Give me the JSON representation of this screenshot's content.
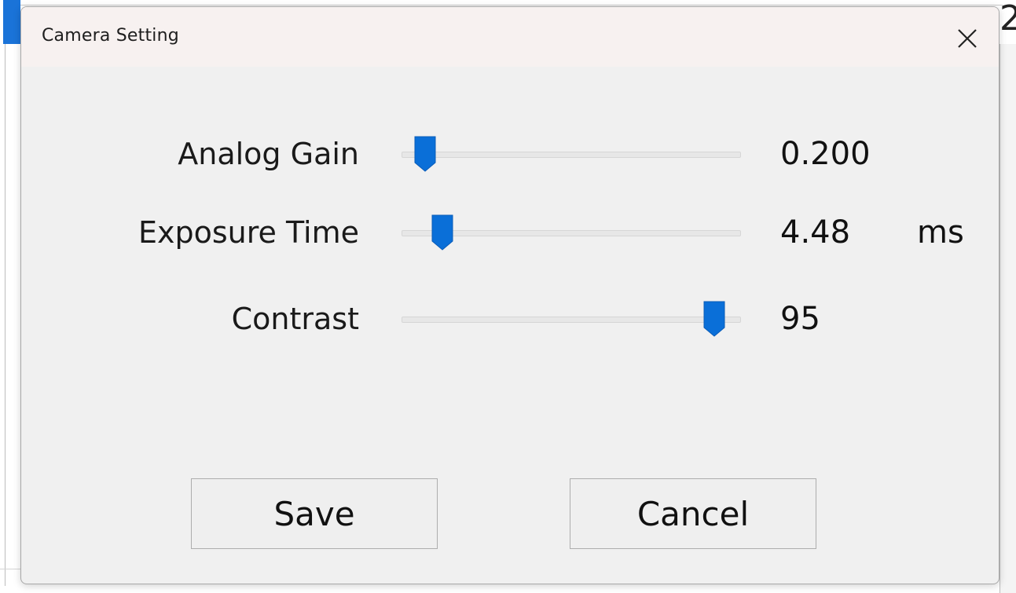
{
  "window": {
    "title": "Camera Setting",
    "close_icon": "close-icon"
  },
  "background": {
    "partial_glyph": "2"
  },
  "settings": [
    {
      "label": "Analog Gain",
      "value_text": "0.200",
      "unit": "",
      "slider_fraction": 0.04
    },
    {
      "label": "Exposure Time",
      "value_text": "4.48",
      "unit": "ms",
      "slider_fraction": 0.095
    },
    {
      "label": "Contrast",
      "value_text": "95",
      "unit": "",
      "slider_fraction": 0.95
    }
  ],
  "buttons": {
    "save_label": "Save",
    "cancel_label": "Cancel"
  },
  "colors": {
    "accent": "#0a6fd8",
    "dialog_bg": "#f0f0f0",
    "titlebar_bg": "#f7f1f0"
  }
}
